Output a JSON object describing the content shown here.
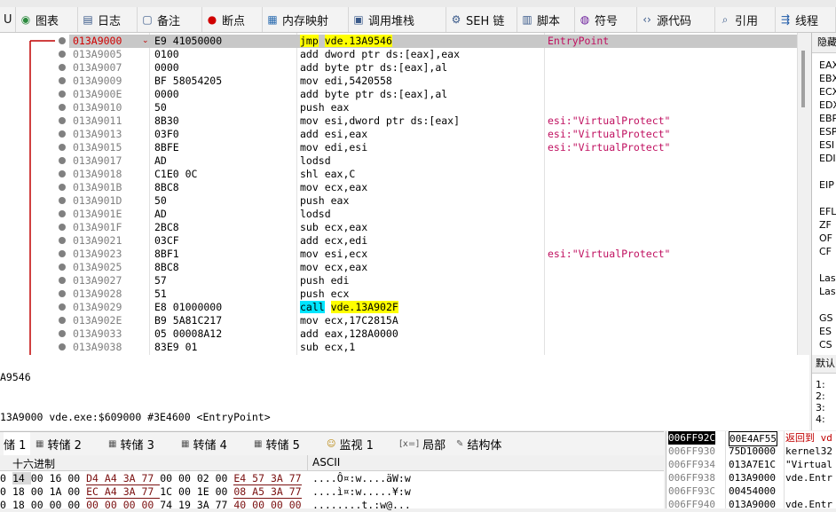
{
  "tabs": [
    {
      "label": "U",
      "icon": ""
    },
    {
      "label": "图表",
      "icon": "graph-icon"
    },
    {
      "label": "日志",
      "icon": "log-icon"
    },
    {
      "label": "备注",
      "icon": "notes-icon"
    },
    {
      "label": "断点",
      "icon": "breakpoint-icon"
    },
    {
      "label": "内存映射",
      "icon": "memory-map-icon"
    },
    {
      "label": "调用堆栈",
      "icon": "call-stack-icon"
    },
    {
      "label": "SEH 链",
      "icon": "seh-chain-icon"
    },
    {
      "label": "脚本",
      "icon": "script-icon"
    },
    {
      "label": "符号",
      "icon": "symbols-icon"
    },
    {
      "label": "源代码",
      "icon": "source-icon"
    },
    {
      "label": "引用",
      "icon": "references-icon"
    },
    {
      "label": "线程",
      "icon": "threads-icon"
    }
  ],
  "disasm": [
    {
      "addr": "013A9000",
      "bytes": "E9 41050000",
      "instr": [
        [
          "jmp",
          "y"
        ],
        [
          " "
        ],
        [
          "vde.13A9546",
          "y"
        ]
      ],
      "comment": "EntryPoint",
      "sel": true
    },
    {
      "addr": "013A9005",
      "bytes": "0100",
      "instr": [
        [
          "add dword ptr ds:[eax],eax"
        ]
      ],
      "comment": ""
    },
    {
      "addr": "013A9007",
      "bytes": "0000",
      "instr": [
        [
          "add byte ptr ds:[eax],al"
        ]
      ],
      "comment": ""
    },
    {
      "addr": "013A9009",
      "bytes": "BF 58054205",
      "instr": [
        [
          "mov edi,5420558"
        ]
      ],
      "comment": ""
    },
    {
      "addr": "013A900E",
      "bytes": "0000",
      "instr": [
        [
          "add byte ptr ds:[eax],al"
        ]
      ],
      "comment": ""
    },
    {
      "addr": "013A9010",
      "bytes": "50",
      "instr": [
        [
          "push eax"
        ]
      ],
      "comment": ""
    },
    {
      "addr": "013A9011",
      "bytes": "8B30",
      "instr": [
        [
          "mov esi,dword ptr ds:[eax]"
        ]
      ],
      "comment": "esi:\"VirtualProtect\""
    },
    {
      "addr": "013A9013",
      "bytes": "03F0",
      "instr": [
        [
          "add esi,eax"
        ]
      ],
      "comment": "esi:\"VirtualProtect\""
    },
    {
      "addr": "013A9015",
      "bytes": "8BFE",
      "instr": [
        [
          "mov edi,esi"
        ]
      ],
      "comment": "esi:\"VirtualProtect\""
    },
    {
      "addr": "013A9017",
      "bytes": "AD",
      "instr": [
        [
          "lodsd"
        ]
      ],
      "comment": ""
    },
    {
      "addr": "013A9018",
      "bytes": "C1E0 0C",
      "instr": [
        [
          "shl eax,C"
        ]
      ],
      "comment": ""
    },
    {
      "addr": "013A901B",
      "bytes": "8BC8",
      "instr": [
        [
          "mov ecx,eax"
        ]
      ],
      "comment": ""
    },
    {
      "addr": "013A901D",
      "bytes": "50",
      "instr": [
        [
          "push eax"
        ]
      ],
      "comment": ""
    },
    {
      "addr": "013A901E",
      "bytes": "AD",
      "instr": [
        [
          "lodsd"
        ]
      ],
      "comment": ""
    },
    {
      "addr": "013A901F",
      "bytes": "2BC8",
      "instr": [
        [
          "sub ecx,eax"
        ]
      ],
      "comment": ""
    },
    {
      "addr": "013A9021",
      "bytes": "03CF",
      "instr": [
        [
          "add ecx,edi"
        ]
      ],
      "comment": ""
    },
    {
      "addr": "013A9023",
      "bytes": "8BF1",
      "instr": [
        [
          "mov esi,ecx"
        ]
      ],
      "comment": "esi:\"VirtualProtect\""
    },
    {
      "addr": "013A9025",
      "bytes": "8BC8",
      "instr": [
        [
          "mov ecx,eax"
        ]
      ],
      "comment": ""
    },
    {
      "addr": "013A9027",
      "bytes": "57",
      "instr": [
        [
          "push edi"
        ]
      ],
      "comment": ""
    },
    {
      "addr": "013A9028",
      "bytes": "51",
      "instr": [
        [
          "push ecx"
        ]
      ],
      "comment": ""
    },
    {
      "addr": "013A9029",
      "bytes": "E8 01000000",
      "instr": [
        [
          "call",
          "c"
        ],
        [
          " "
        ],
        [
          "vde.13A902F",
          "y"
        ]
      ],
      "comment": ""
    },
    {
      "addr": "013A902E",
      "bytes": "B9 5A81C217",
      "instr": [
        [
          "mov ecx,17C2815A"
        ]
      ],
      "comment": ""
    },
    {
      "addr": "013A9033",
      "bytes": "05 00008A12",
      "instr": [
        [
          "add eax,128A0000"
        ]
      ],
      "comment": ""
    },
    {
      "addr": "013A9038",
      "bytes": "83E9 01",
      "instr": [
        [
          "sub ecx,1"
        ]
      ],
      "comment": ""
    }
  ],
  "registers": {
    "header": "隐藏",
    "names": [
      "EAX",
      "EBX",
      "ECX",
      "EDX",
      "EBP",
      "ESP",
      "ESI",
      "EDI",
      "",
      "EIP",
      "",
      "EFL",
      "ZF",
      "OF",
      "CF",
      "",
      "Las",
      "Las",
      "",
      "GS",
      "ES",
      "CS"
    ]
  },
  "info": {
    "line1": "A9546",
    "line2": "13A9000 vde.exe:$609000 #3E4600 <EntryPoint>"
  },
  "callstack": {
    "header": "默认",
    "items": [
      "1:",
      "2:",
      "3:",
      "4:"
    ]
  },
  "dumptabs": [
    "储 1",
    "转储 2",
    "转储 3",
    "转储 4",
    "转储 5",
    "监视 1",
    "局部",
    "结构体"
  ],
  "dump": {
    "hex_header": "十六进制",
    "ascii_header": "ASCII",
    "rows": [
      {
        "pre": "0",
        "hex": "14 00 16 00 D4 A4 3A 77 00 00 02 00 E4 57 3A 77",
        "ascii": "....Ô¤:w....äW:w"
      },
      {
        "pre": "0",
        "hex": "18 00 1A 00 EC A4 3A 77 1C 00 1E 00 08 A5 3A 77",
        "ascii": "....ì¤:w.....¥:w"
      },
      {
        "pre": "0",
        "hex": "18 00 00 00 00 00 00 00 74 19 3A 77 40 00 00 00",
        "ascii": "........t.:w@..."
      }
    ]
  },
  "stack": {
    "rows": [
      {
        "addr": "006FF92C",
        "val": "00E4AF55",
        "cmt": "返回到 vd",
        "sel": true
      },
      {
        "addr": "006FF930",
        "val": "75D10000",
        "cmt": "kernel32"
      },
      {
        "addr": "006FF934",
        "val": "013A7E1C",
        "cmt": "\"Virtual"
      },
      {
        "addr": "006FF938",
        "val": "013A9000",
        "cmt": "vde.Entr"
      },
      {
        "addr": "006FF93C",
        "val": "00454000",
        "cmt": ""
      },
      {
        "addr": "006FF940",
        "val": "013A9000",
        "cmt": "vde.Entr"
      }
    ]
  }
}
